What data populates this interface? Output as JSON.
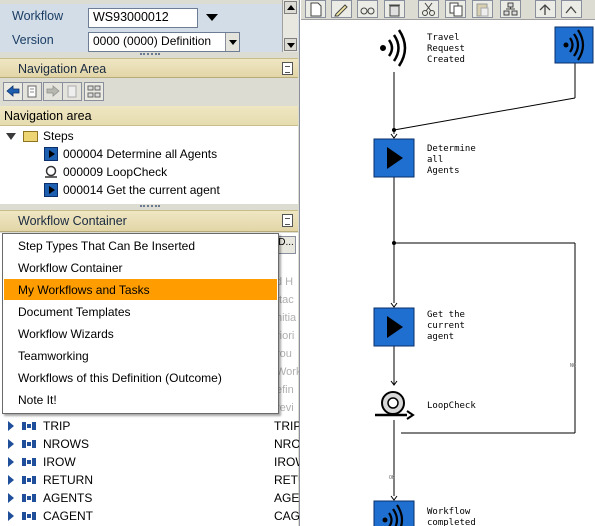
{
  "header": {
    "workflow_label": "Workflow",
    "workflow_value": "WS93000012",
    "version_label": "Version",
    "version_value": "0000 (0000) Definition"
  },
  "nav_section": {
    "title": "Navigation Area"
  },
  "nav_area": {
    "header": "Navigation area",
    "folder": "Steps",
    "items": [
      {
        "label": "000004 Determine all Agents",
        "icon": "activity-step-icon"
      },
      {
        "label": "000009 LoopCheck",
        "icon": "loop-icon"
      },
      {
        "label": "000014 Get the current agent",
        "icon": "activity-step-icon"
      }
    ]
  },
  "container_section": {
    "title": "Workflow Container"
  },
  "menu": {
    "items": [
      "Step Types That Can Be Inserted",
      "Workflow Container",
      "My Workflows and Tasks",
      "Document Templates",
      "Workflow Wizards",
      "Teamworking",
      "Workflows of this Definition (Outcome)",
      "Note It!"
    ],
    "highlighted_index": 2,
    "highlight_color": "#ff9d00"
  },
  "container": {
    "column_button": "D...",
    "ghost_texts": [
      "d H",
      "ttac",
      "nitia",
      "riori",
      "rou",
      "Work",
      "efin",
      "revi"
    ],
    "rows": [
      {
        "name": "TRIP",
        "col2": "TRIP"
      },
      {
        "name": "NROWS",
        "col2": "NRO"
      },
      {
        "name": "IROW",
        "col2": "IROW"
      },
      {
        "name": "RETURN",
        "col2": "RETU"
      },
      {
        "name": "AGENTS",
        "col2": "AGEI"
      },
      {
        "name": "CAGENT",
        "col2": "CAG"
      }
    ]
  },
  "graph": {
    "nodes": {
      "start": "Travel\nRequest\nCreated",
      "determine": "Determine\nall\nAgents",
      "get_agent": "Get the\ncurrent\nagent",
      "loop": "LoopCheck",
      "end": "Workflow\ncompleted"
    },
    "edge_labels": {
      "no": "NO",
      "ok": "OK"
    }
  },
  "colors": {
    "step_blue": "#1f6fd0",
    "nav_header": "#efe6c3",
    "field_bg": "#d3dde8"
  }
}
